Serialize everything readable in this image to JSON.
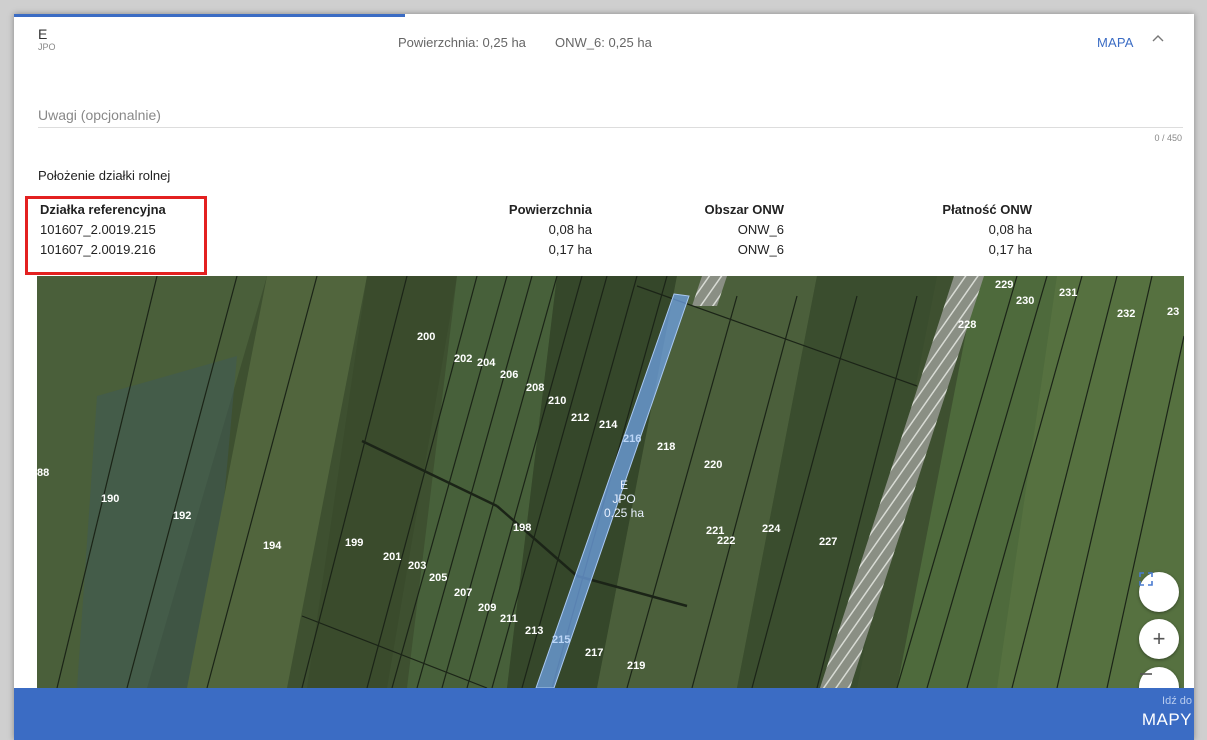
{
  "header": {
    "symbol": "E",
    "type": "JPO",
    "area": "Powierzchnia: 0,25 ha",
    "onw": "ONW_6: 0,25 ha",
    "map_link": "MAPA"
  },
  "notes": {
    "placeholder": "Uwagi (opcjonalnie)",
    "counter": "0 / 450"
  },
  "location": {
    "title": "Położenie działki rolnej",
    "columns": [
      "Działka referencyjna",
      "Powierzchnia",
      "Obszar ONW",
      "Płatność ONW"
    ],
    "rows": [
      [
        "101607_2.0019.215",
        "0,08 ha",
        "ONW_6",
        "0,08 ha"
      ],
      [
        "101607_2.0019.216",
        "0,17 ha",
        "ONW_6",
        "0,17 ha"
      ]
    ]
  },
  "map": {
    "parcel_label": {
      "symbol": "E",
      "type": "JPO",
      "area": "0.25 ha"
    },
    "parcel_numbers": [
      "200",
      "202",
      "204",
      "206",
      "208",
      "210",
      "212",
      "214",
      "216",
      "218",
      "220",
      "88",
      "190",
      "192",
      "194",
      "199",
      "198",
      "201",
      "203",
      "205",
      "207",
      "209",
      "211",
      "213",
      "215",
      "217",
      "219",
      "221",
      "222",
      "224",
      "227",
      "228",
      "229",
      "230",
      "231",
      "232",
      "23"
    ],
    "highlight_color": "#6fa2e6",
    "buttons": {
      "fullscreen": "fullscreen-icon",
      "zoom_in": "+",
      "zoom_out": "zoom-out-icon"
    }
  },
  "footer": {
    "go_to": "Idź do",
    "maps": "MAPY"
  }
}
